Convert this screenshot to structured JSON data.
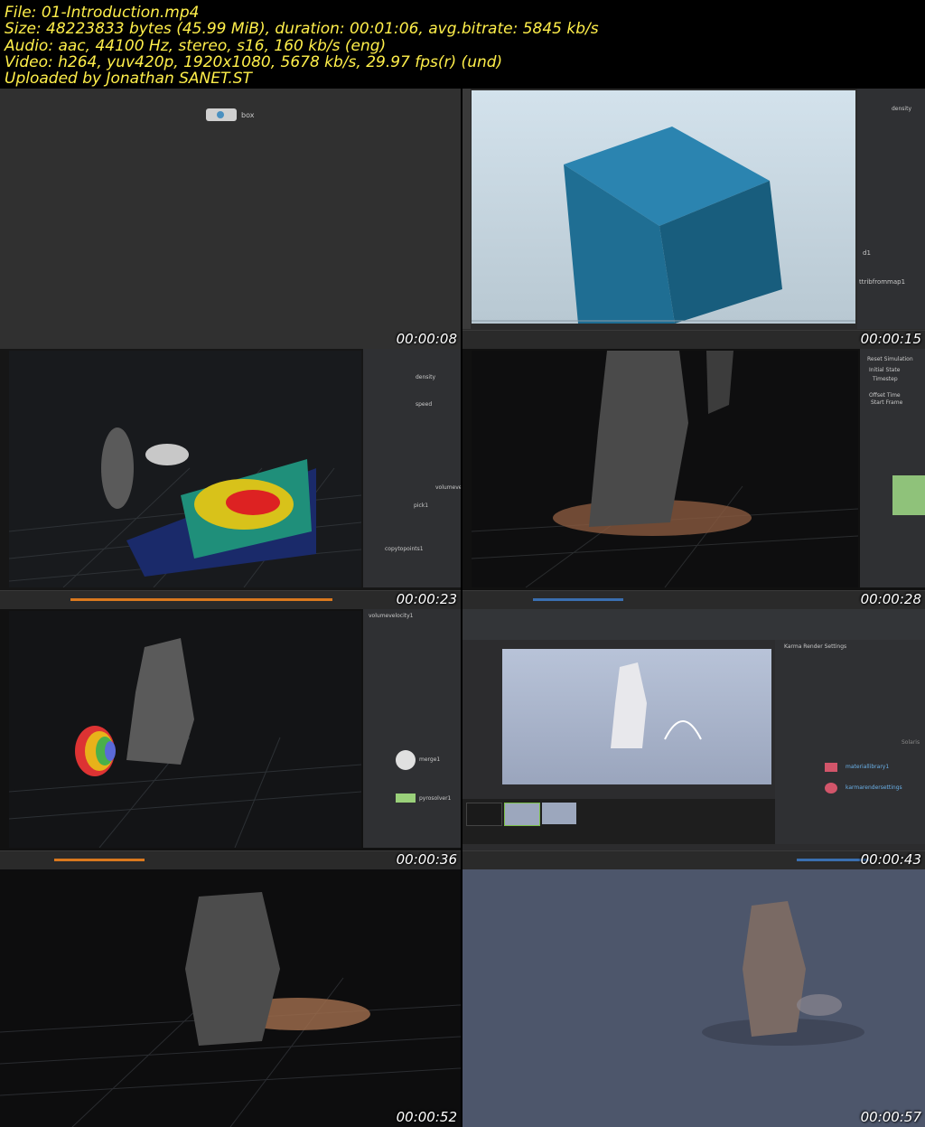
{
  "header": {
    "file": "File: 01-Introduction.mp4",
    "size": "Size: 48223833 bytes (45.99 MiB), duration: 00:01:06, avg.bitrate: 5845 kb/s",
    "audio": "Audio: aac, 44100 Hz, stereo, s16, 160 kb/s (eng)",
    "video": "Video: h264, yuv420p, 1920x1080, 5678 kb/s, 29.97 fps(r) (und)",
    "uploader": "Uploaded by Jonathan SANET.ST"
  },
  "thumbnails": [
    {
      "timestamp": "00:00:08",
      "node_label": "box"
    },
    {
      "timestamp": "00:00:15",
      "labels": [
        "density",
        "d1",
        "ttribfrommap1"
      ]
    },
    {
      "timestamp": "00:00:23",
      "labels": [
        "density",
        "speed",
        "pick1",
        "copytopoints1",
        "volumevelo"
      ]
    },
    {
      "timestamp": "00:00:28",
      "labels": [
        "Reset Simulation",
        "Initial State",
        "Timestep",
        "Offset Time",
        "Start Frame"
      ]
    },
    {
      "timestamp": "00:00:36",
      "labels": [
        "merge1",
        "pyrosolver1",
        "volumevelocity1"
      ]
    },
    {
      "timestamp": "00:00:43",
      "labels": [
        "Karma Render Settings",
        "materiallibrary1",
        "karmarendersettings",
        "Solaris"
      ]
    },
    {
      "timestamp": "00:00:52"
    },
    {
      "timestamp": "00:00:57"
    }
  ],
  "colors": {
    "header_text": "#ffef4a",
    "timeline_accent": "#d9781e",
    "cube": "#1f6e93"
  }
}
